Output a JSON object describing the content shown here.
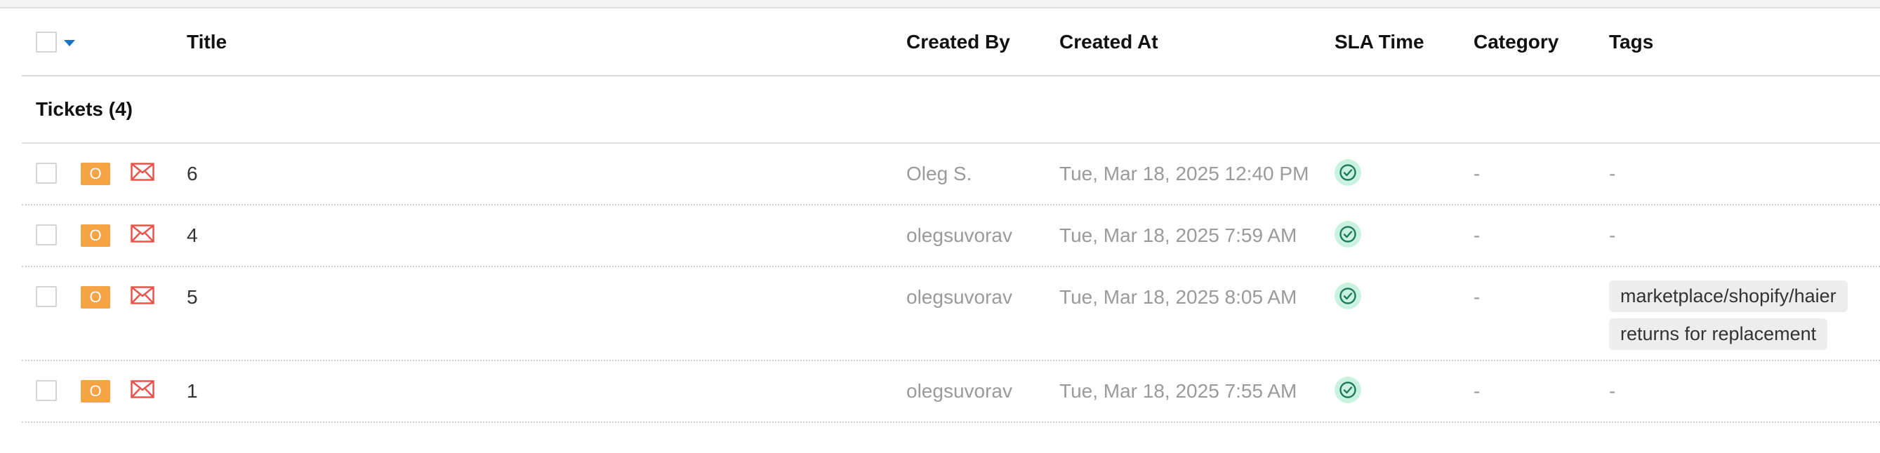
{
  "header": {
    "title": "Title",
    "created_by": "Created By",
    "created_at": "Created At",
    "sla_time": "SLA Time",
    "category": "Category",
    "tags": "Tags"
  },
  "group": {
    "label": "Tickets (4)"
  },
  "colors": {
    "status_badge": "#f5a445",
    "mail_icon": "#e8534a",
    "sla_ok_bg": "#c9f3e0",
    "sla_ok_icon": "#1f7a55",
    "caret": "#1a73c8"
  },
  "tickets": [
    {
      "status": "O",
      "channel_icon": "mail-icon",
      "title": "6",
      "created_by": "Oleg S.",
      "created_at": "Tue, Mar 18, 2025 12:40 PM",
      "sla_icon": "check-circle-icon",
      "category": "-",
      "tags_placeholder": "-",
      "tags": []
    },
    {
      "status": "O",
      "channel_icon": "mail-icon",
      "title": "4",
      "created_by": "olegsuvorav",
      "created_at": "Tue, Mar 18, 2025 7:59 AM",
      "sla_icon": "check-circle-icon",
      "category": "-",
      "tags_placeholder": "-",
      "tags": []
    },
    {
      "status": "O",
      "channel_icon": "mail-icon",
      "title": "5",
      "created_by": "olegsuvorav",
      "created_at": "Tue, Mar 18, 2025 8:05 AM",
      "sla_icon": "check-circle-icon",
      "category": "-",
      "tags_placeholder": "",
      "tags": [
        "marketplace/shopify/haier",
        "returns for replacement"
      ]
    },
    {
      "status": "O",
      "channel_icon": "mail-icon",
      "title": "1",
      "created_by": "olegsuvorav",
      "created_at": "Tue, Mar 18, 2025 7:55 AM",
      "sla_icon": "check-circle-icon",
      "category": "-",
      "tags_placeholder": "-",
      "tags": []
    }
  ]
}
